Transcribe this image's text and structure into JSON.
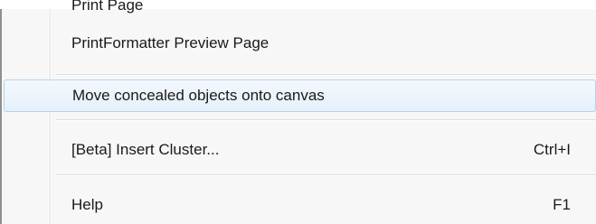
{
  "menu": {
    "items": [
      {
        "label": "Print Page",
        "shortcut": ""
      },
      {
        "label": "PrintFormatter Preview Page",
        "shortcut": ""
      },
      {
        "label": "Move concealed objects onto canvas",
        "shortcut": ""
      },
      {
        "label": "[Beta] Insert Cluster...",
        "shortcut": "Ctrl+I"
      },
      {
        "label": "Help",
        "shortcut": "F1"
      }
    ]
  },
  "colors": {
    "highlight_border": "#b7d2eb",
    "highlight_fill": "#e6f0fa",
    "menu_background": "#f7f7f7",
    "text": "#1a1a1a"
  }
}
